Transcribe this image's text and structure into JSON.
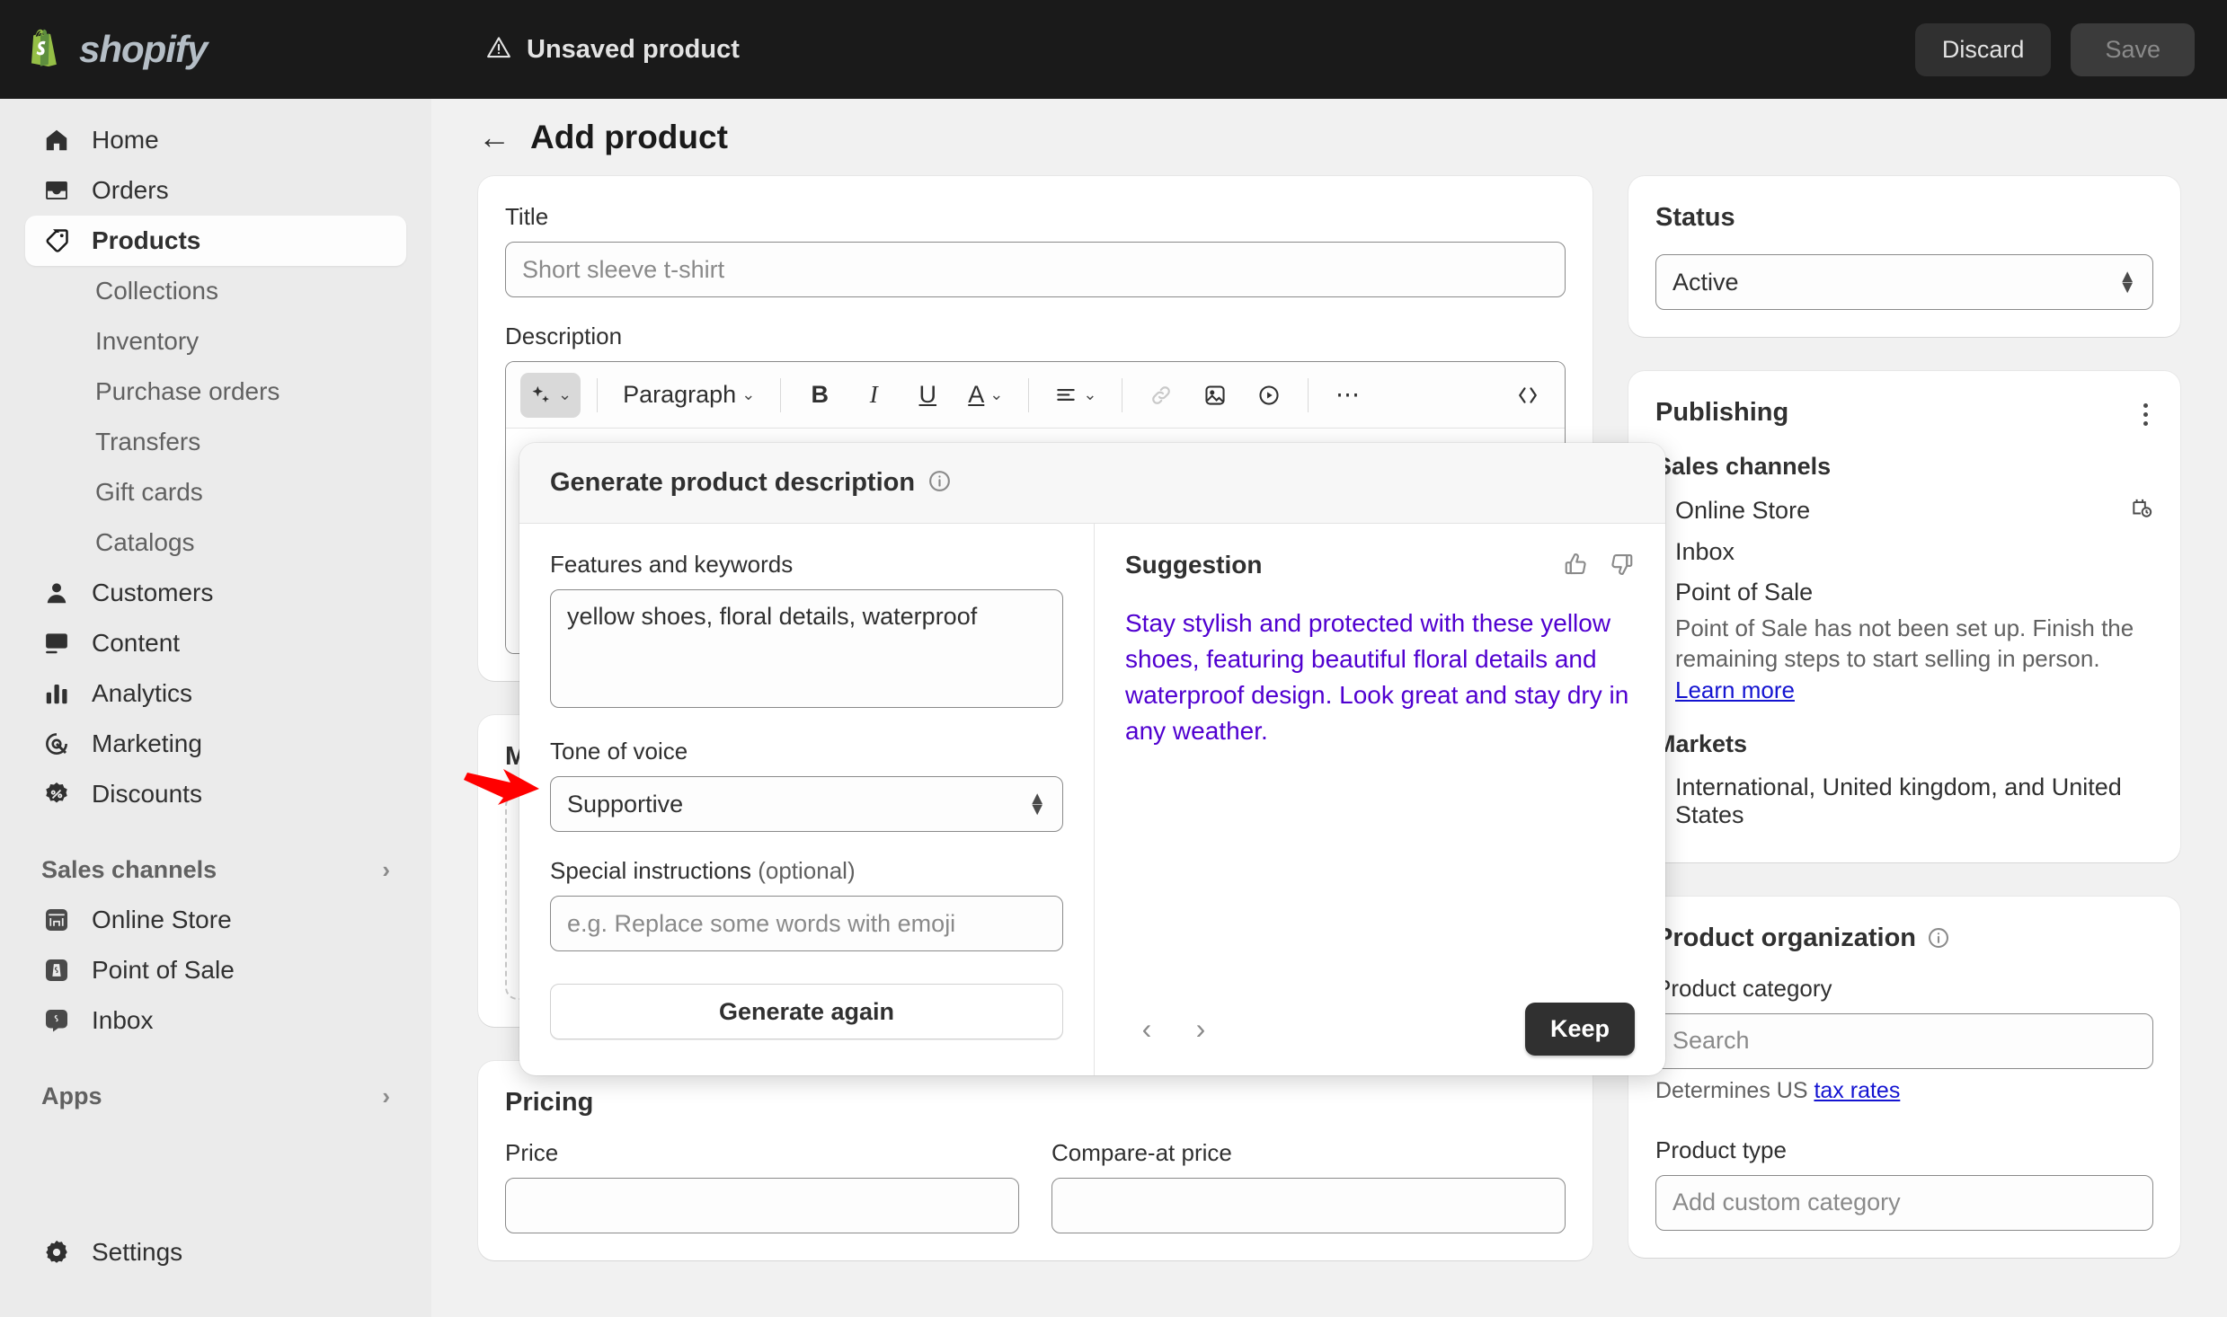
{
  "topbar": {
    "brand": "shopify",
    "status_text": "Unsaved product",
    "warning_icon": "warning-triangle-icon",
    "discard_label": "Discard",
    "save_label": "Save"
  },
  "sidebar": {
    "items": [
      {
        "label": "Home",
        "icon": "home-icon"
      },
      {
        "label": "Orders",
        "icon": "orders-inbox-icon"
      },
      {
        "label": "Products",
        "icon": "product-tag-icon",
        "active": true
      }
    ],
    "product_subitems": [
      {
        "label": "Collections"
      },
      {
        "label": "Inventory"
      },
      {
        "label": "Purchase orders"
      },
      {
        "label": "Transfers"
      },
      {
        "label": "Gift cards"
      },
      {
        "label": "Catalogs"
      }
    ],
    "items2": [
      {
        "label": "Customers",
        "icon": "person-icon"
      },
      {
        "label": "Content",
        "icon": "image-icon"
      },
      {
        "label": "Analytics",
        "icon": "bar-chart-icon"
      },
      {
        "label": "Marketing",
        "icon": "target-cursor-icon"
      },
      {
        "label": "Discounts",
        "icon": "discount-badge-icon"
      }
    ],
    "sales_channels_label": "Sales channels",
    "channels": [
      {
        "label": "Online Store",
        "icon": "storefront-icon"
      },
      {
        "label": "Point of Sale",
        "icon": "pos-bag-icon"
      },
      {
        "label": "Inbox",
        "icon": "inbox-chat-icon"
      }
    ],
    "apps_label": "Apps",
    "settings_label": "Settings"
  },
  "page": {
    "back_icon": "back-arrow-icon",
    "title": "Add product"
  },
  "product_form": {
    "title_label": "Title",
    "title_placeholder": "Short sleeve t-shirt",
    "title_value": "",
    "description_label": "Description",
    "media_label": "Media"
  },
  "editor_toolbar": {
    "magic_label": "magic-sparkle-icon",
    "paragraph_label": "Paragraph",
    "bold": "B",
    "italic": "I",
    "underline": "U",
    "text_color": "A",
    "align": "align-left-icon",
    "link": "link-icon",
    "image": "insert-image-icon",
    "video": "insert-video-icon",
    "more": "more-horizontal-icon",
    "code": "code-brackets-icon"
  },
  "popover": {
    "title": "Generate product description",
    "info_icon": "info-circle-icon",
    "features_label": "Features and keywords",
    "features_value": "yellow shoes, floral details, waterproof",
    "tone_label": "Tone of voice",
    "tone_value": "Supportive",
    "special_label": "Special instructions",
    "special_optional": " (optional)",
    "special_placeholder": "e.g. Replace some words with emoji",
    "generate_again_label": "Generate again",
    "suggestion_label": "Suggestion",
    "thumbs_up_icon": "thumbs-up-icon",
    "thumbs_down_icon": "thumbs-down-icon",
    "suggestion_text": "Stay stylish and protected with these yellow shoes, featuring beautiful floral details and waterproof design. Look great and stay dry in any weather.",
    "prev_icon": "chevron-left-icon",
    "next_icon": "chevron-right-icon",
    "keep_label": "Keep",
    "suggestion_color": "#5000d0"
  },
  "pricing": {
    "section_title": "Pricing",
    "price_label": "Price",
    "compare_label": "Compare-at price"
  },
  "status_card": {
    "title": "Status",
    "value": "Active"
  },
  "publishing_card": {
    "title": "Publishing",
    "menu_icon": "kebab-menu-icon",
    "sales_channels_label": "Sales channels",
    "channels": [
      {
        "label": "Online Store",
        "icon": "schedule-clock-icon"
      },
      {
        "label": "Inbox",
        "icon": ""
      },
      {
        "label": "Point of Sale",
        "icon": ""
      }
    ],
    "pos_note": "Point of Sale has not been set up. Finish the remaining steps to start selling in person.",
    "learn_more_label": "Learn more",
    "markets_label": "Markets",
    "markets_value": "International, United kingdom, and United States"
  },
  "product_org_card": {
    "title": "Product organization",
    "info_icon": "info-circle-icon",
    "category_label": "Product category",
    "category_placeholder": "Search",
    "tax_hint_prefix": "Determines US ",
    "tax_link_label": "tax rates",
    "type_label": "Product type",
    "type_placeholder": "Add custom category"
  },
  "annotation": {
    "arrow_icon": "red-pointer-arrow",
    "color": "#ff0000"
  }
}
